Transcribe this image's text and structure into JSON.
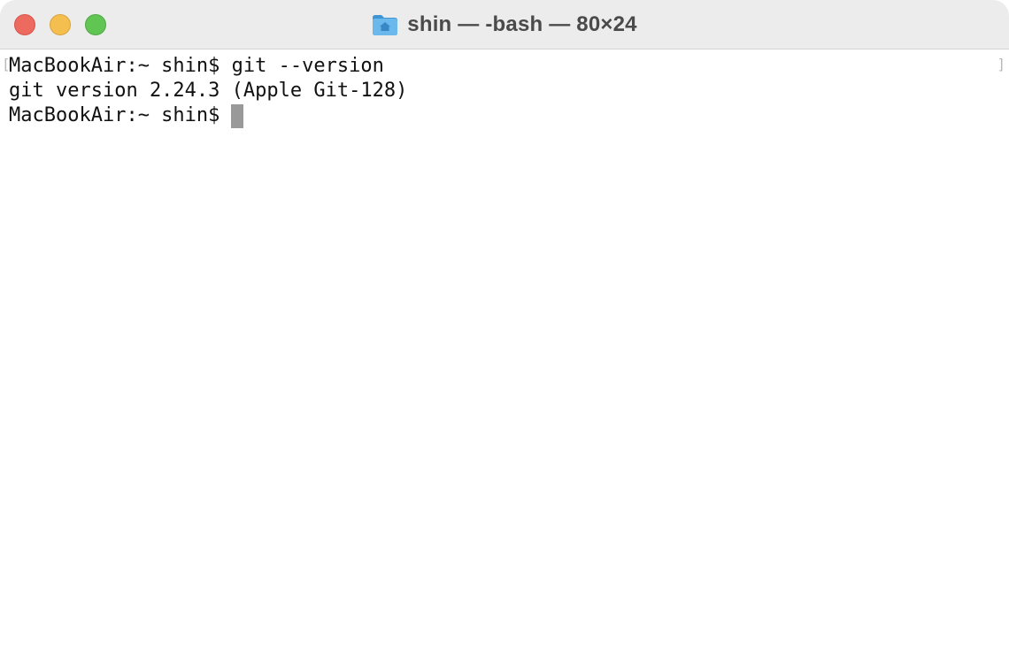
{
  "window": {
    "title": "shin — -bash — 80×24",
    "title_icon": "home-folder-icon"
  },
  "traffic_lights": {
    "close_color": "#ed6a5e",
    "minimize_color": "#f5bf4f",
    "zoom_color": "#61c554"
  },
  "terminal": {
    "lines": [
      "MacBookAir:~ shin$ git --version",
      "git version 2.24.3 (Apple Git-128)",
      "MacBookAir:~ shin$"
    ],
    "cursor_color": "#999999"
  }
}
